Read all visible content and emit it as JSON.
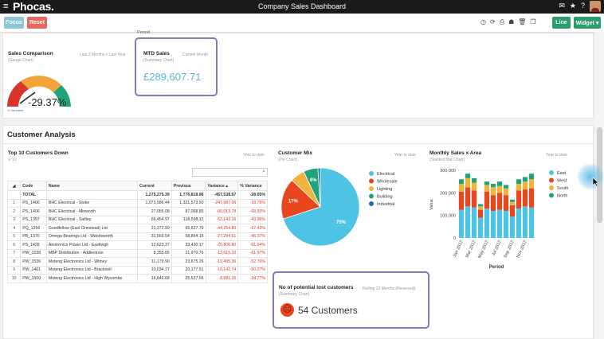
{
  "app": {
    "logo": "Phocas.",
    "title": "Company Sales Dashboard"
  },
  "toolbar": {
    "focus_label": "Focus",
    "reset_label": "Reset",
    "line_label": "Line",
    "widget_label": "Widget ▾"
  },
  "top_section": {
    "period_label": "Period"
  },
  "sales_comparison": {
    "title": "Sales Comparison",
    "subtitle": "(Gauge Chart)",
    "period": "Last 3 Months v Last Year",
    "value_text": "-29.37%",
    "value": -29.37,
    "footnote": "% Variance",
    "colors": {
      "red": "#d9342b",
      "orange": "#f0a43a",
      "green": "#21a37a"
    }
  },
  "mtd_sales": {
    "title": "MTD Sales",
    "period": "Current Month",
    "subtitle": "(Summary Chart)",
    "value": "£289,607.71",
    "value_color": "#5bb8d9"
  },
  "customer_analysis": {
    "title": "Customer Analysis"
  },
  "top10": {
    "title": "Top 10 Customers Down",
    "count": "10",
    "period": "Year to date",
    "columns": [
      "Code",
      "Name",
      "Current",
      "Previous",
      "Variance",
      "% Variance"
    ],
    "total": {
      "label": "TOTAL",
      "current": "1,275,275.39",
      "previous": "1,776,818.96",
      "variance": "-457,538.67",
      "pct": "-28.05%"
    },
    "rows": [
      {
        "n": "1",
        "code": "PS_1400",
        "name": "BHC Electrical - Stoke",
        "current": "1,073,586.44",
        "previous": "1,321,573.50",
        "variance": "-247,987.06",
        "pct": "-18.76%"
      },
      {
        "n": "2",
        "code": "PS_1406",
        "name": "BHC Electrical - Minworth",
        "current": "27,055.08",
        "previous": "87,068.85",
        "variance": "-60,013.78",
        "pct": "-68.93%"
      },
      {
        "n": "3",
        "code": "PS_1397",
        "name": "BHC Electrical - Saltley",
        "current": "66,454.97",
        "previous": "118,598.12",
        "variance": "-52,143.16",
        "pct": "-43.96%"
      },
      {
        "n": "4",
        "code": "PQ_1356",
        "name": "Goodfellow (East Grinstead) Ltd",
        "current": "21,372.99",
        "previous": "65,627.79",
        "variance": "-44,254.80",
        "pct": "-67.43%"
      },
      {
        "n": "5",
        "code": "PB_1370",
        "name": "Omega Bearings Ltd - Wandsworth",
        "current": "31,569.54",
        "previous": "58,864.15",
        "variance": "-27,294.61",
        "pct": "-46.37%"
      },
      {
        "n": "6",
        "code": "PS_1428",
        "name": "Airotronics Power Ltd - Eastleigh",
        "current": "12,623.37",
        "previous": "33,430.17",
        "variance": "-20,806.80",
        "pct": "-61.64%"
      },
      {
        "n": "7",
        "code": "PW_1538",
        "name": "MBP Distribution - Addlestone",
        "current": "8,355.65",
        "previous": "21,970.75",
        "variance": "-13,615.10",
        "pct": "-61.97%"
      },
      {
        "n": "8",
        "code": "PW_1536",
        "name": "Moteng Electronics Ltd - Witney",
        "current": "11,179.90",
        "previous": "23,675.26",
        "variance": "-12,495.36",
        "pct": "-52.76%"
      },
      {
        "n": "9",
        "code": "PW_1401",
        "name": "Moteng Electronics Ltd - Bracknell",
        "current": "10,034.77",
        "previous": "20,177.51",
        "variance": "-10,142.74",
        "pct": "-50.27%"
      },
      {
        "n": "10",
        "code": "PW_1500",
        "name": "Moteng Electronics Ltd - High Wycombe",
        "current": "16,646.68",
        "previous": "25,527.95",
        "variance": "-8,881.26",
        "pct": "-34.77%"
      }
    ]
  },
  "customer_mix": {
    "title": "Customer Mix",
    "subtitle": "(Pie Chart)",
    "period": "Year to date"
  },
  "monthly_sales": {
    "title": "Monthly Sales x Area",
    "subtitle": "(Stacked Bar Chart)",
    "period": "Year to date"
  },
  "lost_customers": {
    "title": "No of potential lost customers",
    "period": "Rolling 12 Months (Reversed)",
    "subtitle": "(Summary Chart)",
    "value": "54 Customers"
  },
  "chart_data": [
    {
      "type": "pie",
      "title": "Customer Mix",
      "categories": [
        "Electrical",
        "Wholesale",
        "Lighting",
        "Building",
        "Industrial"
      ],
      "values": [
        70,
        17,
        6,
        6,
        1
      ],
      "labels": [
        "70%",
        "17%",
        "",
        "6%",
        ""
      ],
      "colors": [
        "#4fc3e3",
        "#e8461f",
        "#f2b33d",
        "#21a37a",
        "#1f6fa8"
      ],
      "legend": "right"
    },
    {
      "type": "bar",
      "stacked": true,
      "title": "Monthly Sales x Area",
      "xlabel": "Period",
      "ylabel": "Value",
      "ylim": [
        0,
        300000
      ],
      "yticks": [
        "0",
        "100,000",
        "200,000",
        "300,000"
      ],
      "tick_labels": [
        "Jan 2017",
        "Mar 2017",
        "May 2017",
        "Jul 2017",
        "Sep 2017",
        "Nov 2017"
      ],
      "x": [
        "Jan 2017",
        "Feb 2017",
        "Mar 2017",
        "Apr 2017",
        "May 2017",
        "Jun 2017",
        "Jul 2017",
        "Aug 2017",
        "Sep 2017",
        "Oct 2017",
        "Nov 2017",
        "Dec 2017"
      ],
      "series": [
        {
          "name": "East",
          "color": "#4fc3e3",
          "values": [
            125000,
            140000,
            135000,
            90000,
            130000,
            120000,
            125000,
            120000,
            95000,
            130000,
            140000,
            135000
          ]
        },
        {
          "name": "West",
          "color": "#e8461f",
          "values": [
            80000,
            85000,
            75000,
            35000,
            75000,
            70000,
            75000,
            70000,
            50000,
            80000,
            75000,
            85000
          ]
        },
        {
          "name": "South",
          "color": "#f2b33d",
          "values": [
            35000,
            40000,
            35000,
            15000,
            30000,
            35000,
            30000,
            30000,
            15000,
            30000,
            35000,
            40000
          ]
        },
        {
          "name": "North",
          "color": "#21a37a",
          "values": [
            20000,
            20000,
            20000,
            10000,
            15000,
            15000,
            20000,
            15000,
            10000,
            20000,
            20000,
            25000
          ]
        }
      ],
      "legend": "right"
    }
  ]
}
